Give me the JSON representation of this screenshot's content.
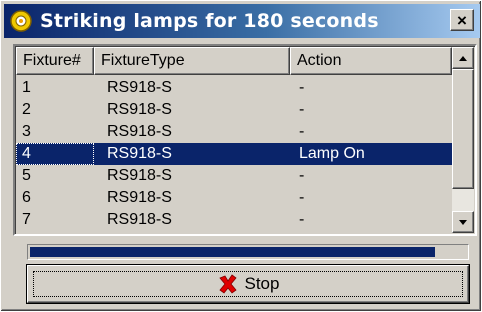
{
  "window": {
    "title": "Striking lamps for 180 seconds",
    "close_label": "×"
  },
  "columns": [
    "Fixture#",
    "FixtureType",
    "Action"
  ],
  "rows": [
    {
      "fixture": "1",
      "type": "RS918-S",
      "action": "-"
    },
    {
      "fixture": "2",
      "type": "RS918-S",
      "action": "-"
    },
    {
      "fixture": "3",
      "type": "RS918-S",
      "action": "-"
    },
    {
      "fixture": "4",
      "type": "RS918-S",
      "action": "Lamp On",
      "selected": true
    },
    {
      "fixture": "5",
      "type": "RS918-S",
      "action": "-"
    },
    {
      "fixture": "6",
      "type": "RS918-S",
      "action": "-"
    },
    {
      "fixture": "7",
      "type": "RS918-S",
      "action": "-"
    }
  ],
  "progress": {
    "fraction": 0.93
  },
  "stop_button": {
    "label": "Stop",
    "icon": "red-x-icon"
  },
  "colors": {
    "selection": "#0a246a",
    "progress": "#0a246a",
    "face": "#d4d0c8",
    "stop_icon": "#e00000"
  }
}
